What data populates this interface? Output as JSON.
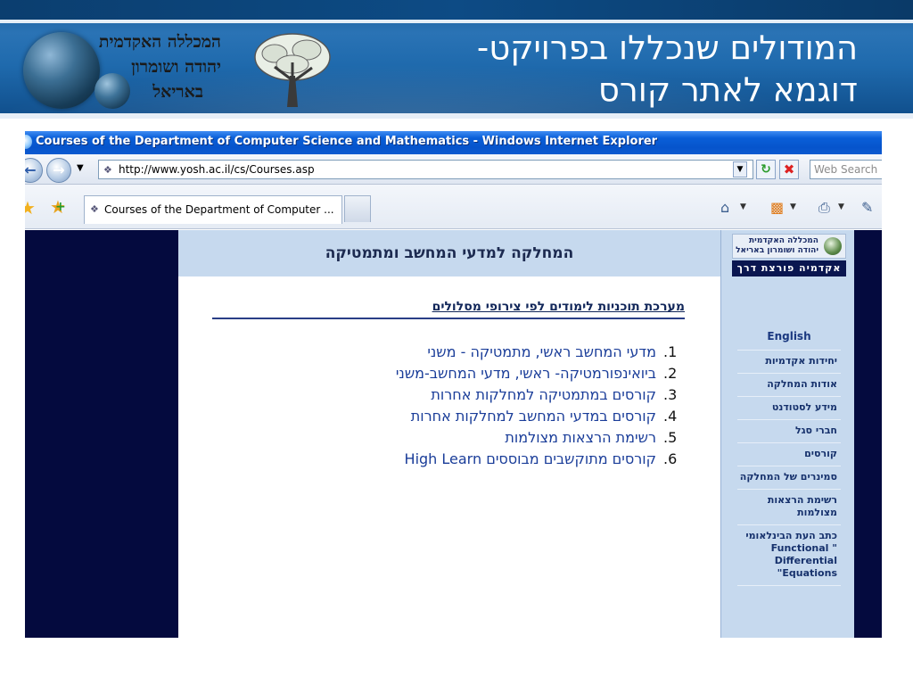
{
  "slide": {
    "title_line1": "המודולים שנכללו בפרויקט-",
    "title_line2": "דוגמא לאתר קורס",
    "logo_lines": [
      "המכללה האקדמית",
      "יהודה ושומרון",
      "באריאל"
    ]
  },
  "browser": {
    "window_title": "Courses of the Department of Computer Science and Mathematics - Windows Internet Explorer",
    "url": "http://www.yosh.ac.il/cs/Courses.asp",
    "search_placeholder": "Web Search",
    "tab_label": "Courses of the Department of Computer ...",
    "icons": {
      "back": "back-arrow-icon",
      "forward": "forward-arrow-icon",
      "refresh": "refresh-icon",
      "stop": "stop-icon",
      "favorites": "star-icon",
      "add_favorites": "add-favorite-icon",
      "home": "home-icon",
      "rss": "rss-icon",
      "print": "print-icon",
      "page": "page-icon"
    }
  },
  "page": {
    "dept_header": "המחלקה למדעי המחשב ומתמטיקה",
    "section_heading": "מערכת תוכניות לימודים לפי צירופי מסלולים",
    "courses": [
      {
        "num": "1.",
        "label": "מדעי המחשב ראשי, מתמטיקה - משני"
      },
      {
        "num": "2.",
        "label": "ביואינפורמטיקה- ראשי, מדעי המחשב-משני"
      },
      {
        "num": "3.",
        "label": "קורסים במתמטיקה למחלקות אחרות"
      },
      {
        "num": "4.",
        "label": "קורסים במדעי המחשב למחלקות אחרות"
      },
      {
        "num": "5.",
        "label": "רשימת הרצאות מצולמות"
      },
      {
        "num": "6.",
        "label": "קורסים מתוקשבים מבוססים High Learn"
      }
    ],
    "sidebar": {
      "logo_line1": "המכללה האקדמית",
      "logo_line2": "יהודה ושומרון באריאל",
      "tagline": "אקדמיה פורצת דרך",
      "menu": [
        "English",
        "יחידות אקדמיות",
        "אודות המחלקה",
        "מידע לסטודנט",
        "חברי סגל",
        "קורסים",
        "סמינרים של המחלקה",
        "רשימת הרצאות מצולמות",
        "כתב העת הבינלאומי \" Functional Differential Equations\""
      ]
    }
  },
  "colors": {
    "header_blue": "#1f6aad",
    "ie_titlebar": "#0654cc",
    "page_dark": "#040a3e",
    "dept_header_bg": "#c6d9ee",
    "link_blue": "#1a3d99"
  }
}
